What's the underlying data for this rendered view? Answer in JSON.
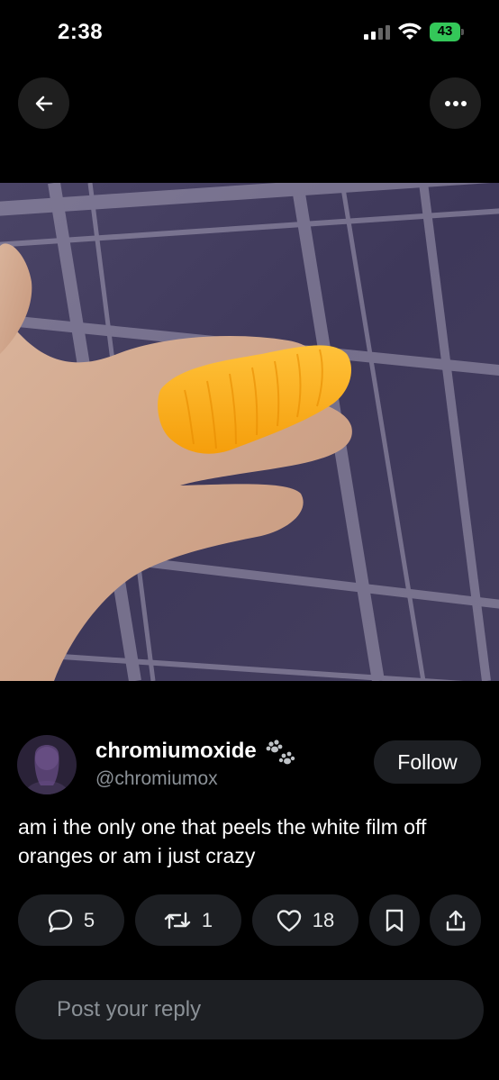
{
  "status_bar": {
    "time": "2:38",
    "battery": "43"
  },
  "post": {
    "display_name": "chromiumoxide",
    "handle": "@chromiumox",
    "follow_label": "Follow",
    "text": "am i the only one that peels the white film off oranges or am i just crazy",
    "image_alt_content": "hand holding orange segment on purple plaid fabric"
  },
  "actions": {
    "replies": "5",
    "reposts": "1",
    "likes": "18"
  },
  "reply": {
    "placeholder": "Post your reply"
  },
  "colors": {
    "background": "#000000",
    "pill": "#1d1f23",
    "battery": "#34c759",
    "secondary_text": "#8b9197"
  },
  "icons": [
    "back-arrow-icon",
    "more-icon",
    "signal-icon",
    "wifi-icon",
    "battery-icon",
    "paw-icon",
    "reply-icon",
    "repost-icon",
    "like-icon",
    "bookmark-icon",
    "share-icon"
  ]
}
